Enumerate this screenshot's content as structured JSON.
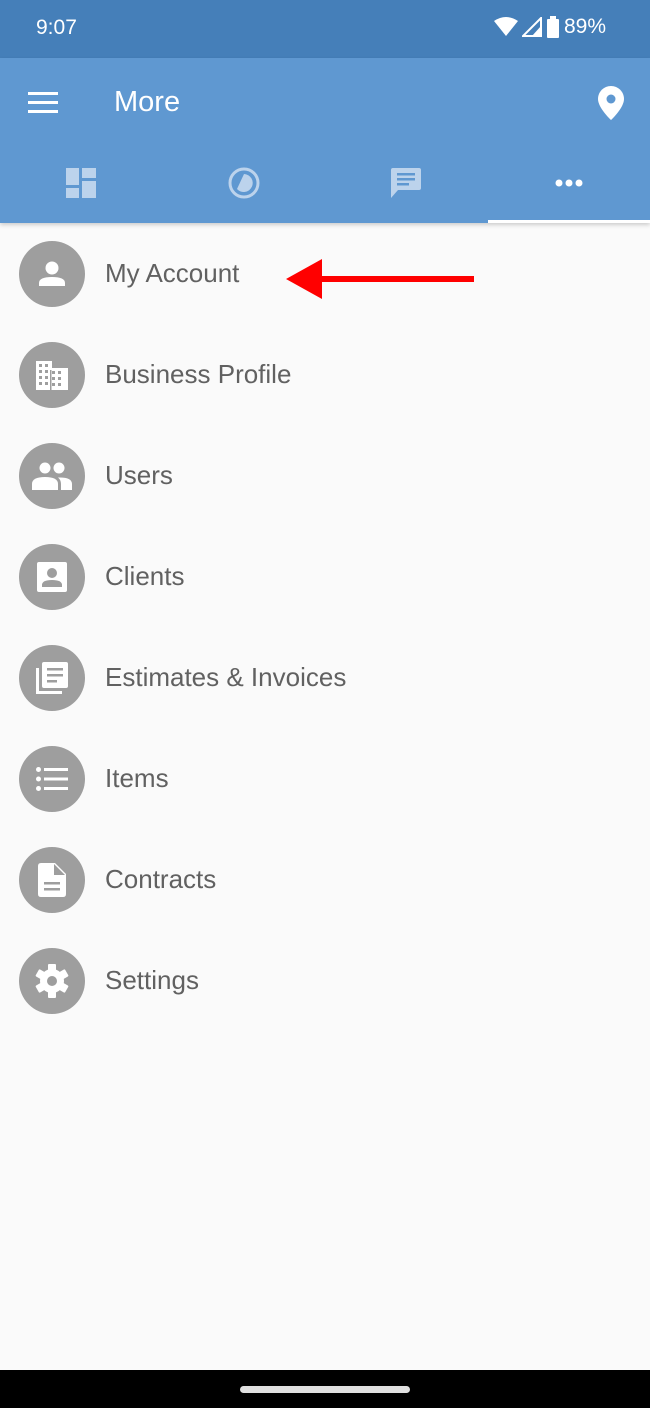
{
  "status_bar": {
    "time": "9:07",
    "battery": "89%",
    "icons": [
      "wifi-icon",
      "cellular-signal-icon",
      "battery-icon"
    ]
  },
  "app_bar": {
    "title": "More",
    "left_icon": "menu-icon",
    "right_icon": "location-pin-icon",
    "accent_color": "#5f98d1",
    "status_color": "#457fb9"
  },
  "tabs": [
    {
      "icon": "dashboard-icon",
      "active": false
    },
    {
      "icon": "timer-icon",
      "active": false
    },
    {
      "icon": "message-icon",
      "active": false
    },
    {
      "icon": "more-horiz-icon",
      "active": true
    }
  ],
  "menu": {
    "items": [
      {
        "label": "My Account",
        "icon": "person-icon"
      },
      {
        "label": "Business Profile",
        "icon": "business-icon"
      },
      {
        "label": "Users",
        "icon": "people-icon"
      },
      {
        "label": "Clients",
        "icon": "contact-icon"
      },
      {
        "label": "Estimates & Invoices",
        "icon": "documents-icon"
      },
      {
        "label": "Items",
        "icon": "list-icon"
      },
      {
        "label": "Contracts",
        "icon": "file-icon"
      },
      {
        "label": "Settings",
        "icon": "gear-icon"
      }
    ]
  },
  "annotation": {
    "type": "arrow",
    "points_to": "My Account",
    "color": "#ff0000"
  }
}
